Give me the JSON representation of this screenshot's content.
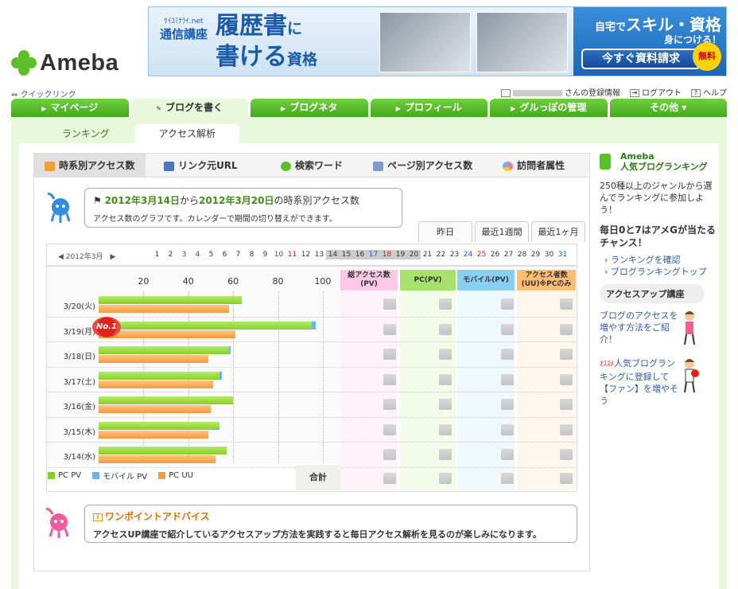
{
  "header": {
    "logo_text": "Ameba",
    "banner": {
      "provider_small": "ｹｲｺﾐﾅﾗｲ.net",
      "provider": "通信講座",
      "title_line1": "履歴書",
      "title_line1_suffix": "に",
      "title_line2": "書ける",
      "title_line2_suffix": "資格",
      "right_line1_small": "自宅で",
      "right_line1": "スキル・資格",
      "right_line2": "身につける！",
      "cta": "今すぐ資料請求",
      "free": "無料"
    }
  },
  "util": {
    "quicklink": "クイックリンク",
    "registration": "さんの登録情報",
    "logout": "ログアウト",
    "help": "ヘルプ"
  },
  "mainnav": [
    {
      "label": "マイページ"
    },
    {
      "label": "ブログを書く"
    },
    {
      "label": "ブログネタ"
    },
    {
      "label": "プロフィール"
    },
    {
      "label": "グルっぽの管理"
    },
    {
      "label": "その他 ▾"
    }
  ],
  "subtabs": {
    "ranking": "ランキング",
    "analytics": "アクセス解析"
  },
  "tools": [
    {
      "label": "時系別アクセス数",
      "icon": "clock-icon",
      "color": "#f0a030"
    },
    {
      "label": "リンク元URL",
      "icon": "page-icon",
      "color": "#4a78c0"
    },
    {
      "label": "検索ワード",
      "icon": "chat-icon",
      "color": "#5cbf2a"
    },
    {
      "label": "ページ別アクセス数",
      "icon": "document-icon",
      "color": "#7a9cd0"
    },
    {
      "label": "訪問者属性",
      "icon": "pie-icon",
      "color": "#f07ab0"
    }
  ],
  "bubble": {
    "date_from": "2012年3月14日",
    "from": "から",
    "date_to": "2012年3月20日",
    "suffix": "の時系別アクセス数",
    "desc": "アクセス数のグラフです。カレンダーで期間の切り替えができます。"
  },
  "periods": {
    "yesterday": "昨日",
    "week": "最近1週間",
    "month": "最近1ヶ月"
  },
  "calendar": {
    "month": "2012年3月",
    "days": [
      {
        "d": "1",
        "t": ""
      },
      {
        "d": "2",
        "t": ""
      },
      {
        "d": "3",
        "t": "sat"
      },
      {
        "d": "4",
        "t": "sun"
      },
      {
        "d": "5",
        "t": ""
      },
      {
        "d": "6",
        "t": ""
      },
      {
        "d": "7",
        "t": ""
      },
      {
        "d": "8",
        "t": ""
      },
      {
        "d": "9",
        "t": ""
      },
      {
        "d": "10",
        "t": "sat"
      },
      {
        "d": "11",
        "t": "sun"
      },
      {
        "d": "12",
        "t": ""
      },
      {
        "d": "13",
        "t": ""
      },
      {
        "d": "14",
        "t": "sel"
      },
      {
        "d": "15",
        "t": "sel"
      },
      {
        "d": "16",
        "t": "sel"
      },
      {
        "d": "17",
        "t": "sel sat"
      },
      {
        "d": "18",
        "t": "sel sun"
      },
      {
        "d": "19",
        "t": "sel"
      },
      {
        "d": "20",
        "t": "sel"
      },
      {
        "d": "21",
        "t": ""
      },
      {
        "d": "22",
        "t": ""
      },
      {
        "d": "23",
        "t": ""
      },
      {
        "d": "24",
        "t": "sat"
      },
      {
        "d": "25",
        "t": "sun"
      },
      {
        "d": "26",
        "t": ""
      },
      {
        "d": "27",
        "t": ""
      },
      {
        "d": "28",
        "t": ""
      },
      {
        "d": "29",
        "t": ""
      },
      {
        "d": "30",
        "t": ""
      },
      {
        "d": "31",
        "t": "sat"
      }
    ]
  },
  "table": {
    "col_total": "総アクセス数\n(PV)",
    "col_pc": "PC(PV)",
    "col_mobile": "モバイル(PV)",
    "col_uu": "アクセス者数\n(UU)※PCのみ",
    "sum_label": "合計",
    "no1_badge": "No.1"
  },
  "legend": {
    "pc": "PC PV",
    "mobile": "モバイル PV",
    "uu": "PC UU"
  },
  "colors": {
    "pc": "#86cf2a",
    "mobile": "#6cb4e8",
    "uu": "#f79b3d",
    "brand_green": "#5cbf2a"
  },
  "chart_data": {
    "type": "bar",
    "orientation": "horizontal",
    "categories": [
      "3/20(火)",
      "3/19(月)",
      "3/18(日)",
      "3/17(土)",
      "3/16(金)",
      "3/15(木)",
      "3/14(水)"
    ],
    "series": [
      {
        "name": "PC PV",
        "values": [
          64,
          95,
          58,
          54,
          60,
          54,
          57
        ]
      },
      {
        "name": "モバイル PV",
        "values": [
          0,
          2,
          1,
          1,
          0,
          0,
          0
        ]
      },
      {
        "name": "PC UU",
        "values": [
          58,
          61,
          49,
          51,
          50,
          49,
          52
        ]
      }
    ],
    "xticks": [
      20,
      40,
      60,
      80,
      100
    ],
    "xlim": [
      0,
      105
    ],
    "grid": true,
    "legend": "bottom-left"
  },
  "advice": {
    "title": "ワンポイントアドバイス",
    "body": "アクセスUP講座で紹介しているアクセスアップ方法を実践すると毎日アクセス解析を見るのが楽しみになります。"
  },
  "sidebar": {
    "rank_brand": "Ameba",
    "rank_title": "人気ブログランキング",
    "rank_desc": "250種以上のジャンルから選んでランキングに参加しよう！",
    "campaign": "毎日0と7はアメGが当たるチャンス！",
    "link_rank": "ランキングを確認",
    "link_top": "ブログランキングトップ",
    "course_title": "アクセスアップ講座",
    "course_link": "ブログのアクセスを増やす方法をご紹介！",
    "osusume": "ｵｽｽﾒ",
    "fan_link": "人気ブログランキングに登録して【ファン】を増やそう"
  }
}
